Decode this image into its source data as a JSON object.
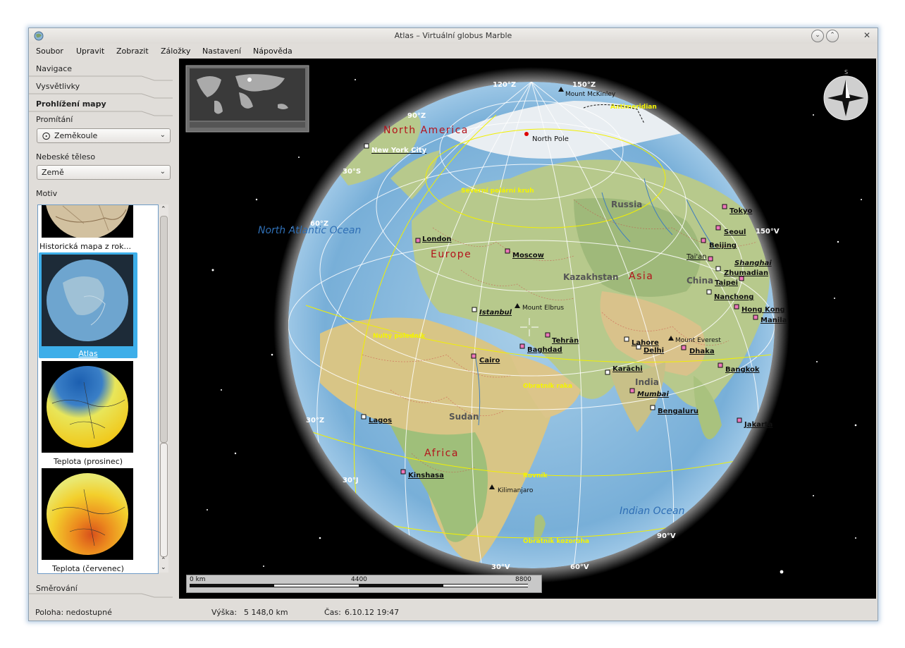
{
  "window": {
    "title": "Atlas – Virtuální globus Marble"
  },
  "menu": [
    "Soubor",
    "Upravit",
    "Zobrazit",
    "Záložky",
    "Nastavení",
    "Nápověda"
  ],
  "sidebar": {
    "tabs": {
      "navigation": "Navigace",
      "legend": "Vysvětlivky",
      "map_view": "Prohlížení mapy",
      "routing": "Směrování"
    },
    "projection": {
      "label": "Promítání",
      "value": "Zeměkoule"
    },
    "celestial_body": {
      "label": "Nebeské těleso",
      "value": "Země"
    },
    "theme": {
      "label": "Motiv",
      "items": [
        {
          "label": "Historická mapa z rok..."
        },
        {
          "label": "Atlas",
          "selected": true
        },
        {
          "label": "Teplota (prosinec)"
        },
        {
          "label": "Teplota (červenec)"
        }
      ]
    }
  },
  "map": {
    "continents": [
      "North America",
      "Europe",
      "Asia",
      "Africa"
    ],
    "oceans": [
      "North Atlantic Ocean",
      "Indian Ocean"
    ],
    "countries": [
      "Russia",
      "Kazakhstan",
      "China",
      "India",
      "Sudan"
    ],
    "cities": [
      "New York City",
      "London",
      "Moscow",
      "Istanbul",
      "Tehrān",
      "Baghdad",
      "Cairo",
      "Lagos",
      "Kinshasa",
      "Karāchi",
      "Lahore",
      "Delhi",
      "Mumbai",
      "Bengaluru",
      "Dhaka",
      "Bangkok",
      "Tokyo",
      "Seoul",
      "Beijing",
      "Tai'an",
      "Shanghai",
      "Zhumadian",
      "Taipei",
      "Nanchong",
      "Hong Kong",
      "Manila",
      "Jakarta"
    ],
    "peaks": [
      "Mount McKinley",
      "Mount Elbrus",
      "Mount Everest",
      "Kilimanjaro"
    ],
    "special": [
      "North Pole"
    ],
    "lines": [
      "Antimeridian",
      "Severní polární kruh",
      "Nultý poledník",
      "Obratník raka",
      "Rovník",
      "Obratník kozoroha"
    ],
    "coordinates": [
      "120°Z",
      "150°Z",
      "90°Z",
      "60°Z",
      "30°S",
      "150°V",
      "30°Z",
      "30°J",
      "90°V",
      "30°V",
      "60°V"
    ],
    "compass_north": "S",
    "scale": {
      "ticks": [
        "0 km",
        "4400",
        "8800"
      ]
    }
  },
  "status": {
    "position": "Poloha: nedostupné",
    "altitude_label": "Výška:",
    "altitude": "5 148,0 km",
    "time_label": "Čas:",
    "time": "6.10.12 19:47"
  }
}
